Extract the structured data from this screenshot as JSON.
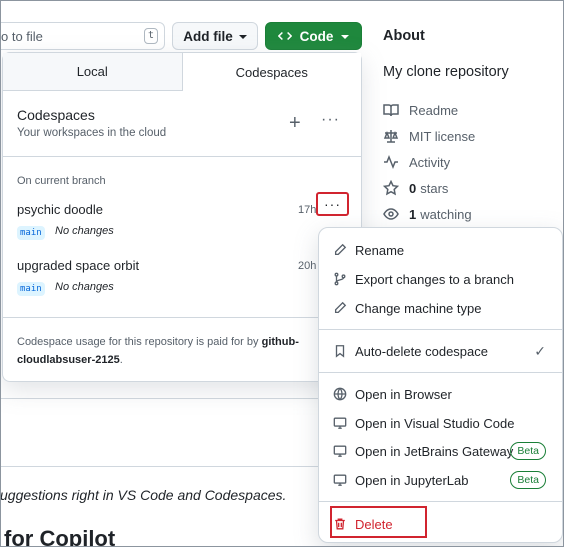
{
  "toolbar": {
    "goto_placeholder": "o to file",
    "goto_shortcut": "t",
    "add_file_label": "Add file",
    "code_label": "Code"
  },
  "about": {
    "title": "About",
    "description": "My clone repository",
    "items": [
      {
        "icon": "book-icon",
        "label": "Readme"
      },
      {
        "icon": "law-icon",
        "label": "MIT license"
      },
      {
        "icon": "pulse-icon",
        "label": "Activity"
      },
      {
        "icon": "star-icon",
        "count": "0",
        "label": "stars"
      },
      {
        "icon": "eye-icon",
        "count": "1",
        "label": "watching"
      }
    ]
  },
  "panel": {
    "tabs": [
      "Local",
      "Codespaces"
    ],
    "active_tab": "Codespaces",
    "header_title": "Codespaces",
    "header_subtitle": "Your workspaces in the cloud",
    "section_label": "On current branch",
    "codespaces": [
      {
        "name": "psychic doodle",
        "time": "17h",
        "branch": "main",
        "status": "No changes"
      },
      {
        "name": "upgraded space orbit",
        "time": "20h",
        "branch": "main",
        "status": "No changes"
      }
    ],
    "footer_text": "Codespace usage for this repository is paid for by",
    "footer_owner": "github-cloudlabsuser-2125",
    "footer_end": "."
  },
  "menu": {
    "items": [
      {
        "icon": "pencil-icon",
        "label": "Rename"
      },
      {
        "icon": "branch-icon",
        "label": "Export changes to a branch"
      },
      {
        "icon": "pencil-icon",
        "label": "Change machine type"
      },
      {
        "icon": "bookmark-icon",
        "label": "Auto-delete codespace",
        "checked": true
      },
      {
        "icon": "globe-icon",
        "label": "Open in Browser"
      },
      {
        "icon": "monitor-icon",
        "label": "Open in Visual Studio Code"
      },
      {
        "icon": "monitor-icon",
        "label": "Open in JetBrains Gateway",
        "badge": "Beta"
      },
      {
        "icon": "monitor-icon",
        "label": "Open in JupyterLab",
        "badge": "Beta"
      },
      {
        "icon": "trash-icon",
        "label": "Delete",
        "danger": true
      }
    ],
    "check_glyph": "✓"
  },
  "background": {
    "line1": "uggestions right in VS Code and Codespaces.",
    "line2": "for Copilot"
  },
  "colors": {
    "primary_green": "#1f883d",
    "danger_red": "#d1242f",
    "highlight_red": "#d1242f",
    "branch_blue": "#0969da",
    "beta_green": "#1a7f37"
  }
}
